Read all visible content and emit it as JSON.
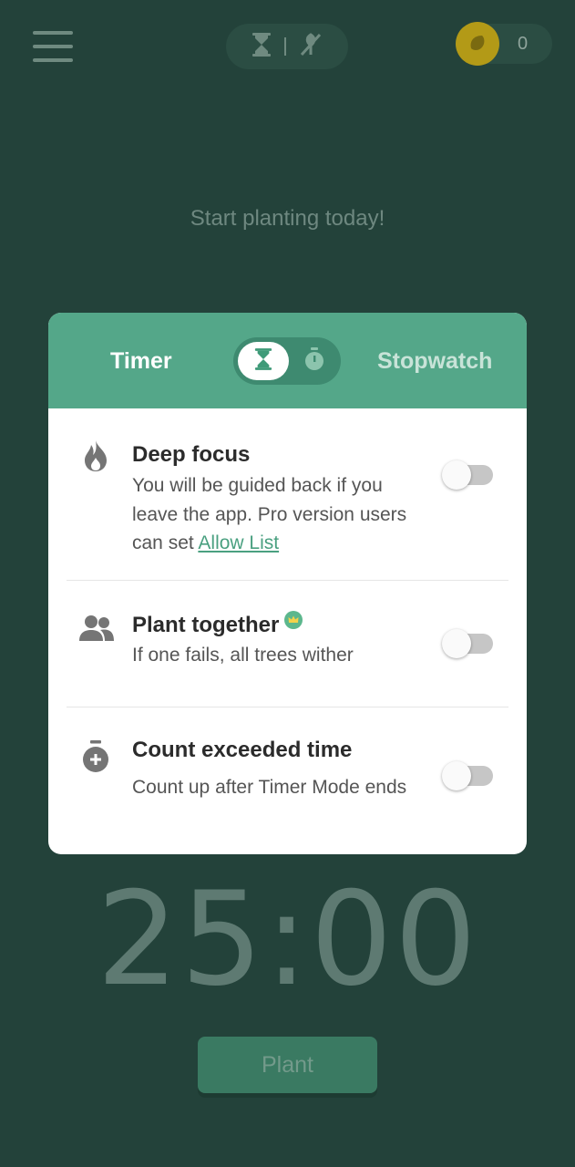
{
  "header": {
    "coin_count": "0",
    "icons": [
      "menu-icon",
      "hourglass-icon",
      "no-plant-icon",
      "coin-icon"
    ]
  },
  "headline": "Start planting today!",
  "mode_card": {
    "tab_timer": "Timer",
    "tab_stopwatch": "Stopwatch",
    "selected": "Timer",
    "options": [
      {
        "icon": "flame-icon",
        "title": "Deep focus",
        "desc_prefix": "You will be guided back if you leave the app. Pro version users can set ",
        "link": "Allow List",
        "enabled": false
      },
      {
        "icon": "people-icon",
        "title": "Plant together",
        "desc": "If one fails, all trees wither",
        "enabled": false
      },
      {
        "icon": "stopwatch-plus-icon",
        "title": "Count exceeded time",
        "desc": "Count up after Timer Mode ends",
        "enabled": false
      }
    ]
  },
  "timer": {
    "display": "25:00"
  },
  "plant_button": "Plant",
  "colors": {
    "background": "#23423a",
    "accent": "#54a789",
    "coin": "#b39a17"
  }
}
